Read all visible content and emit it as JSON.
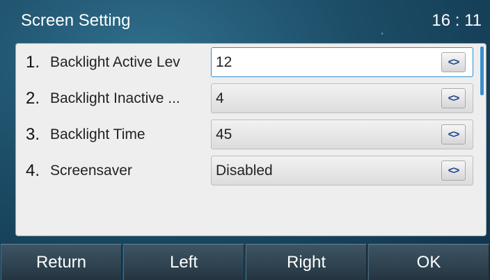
{
  "header": {
    "title": "Screen Setting",
    "clock": "16 : 11"
  },
  "settings": [
    {
      "index": "1.",
      "label": "Backlight Active Lev",
      "value": "12"
    },
    {
      "index": "2.",
      "label": "Backlight Inactive ...",
      "value": "4"
    },
    {
      "index": "3.",
      "label": "Backlight Time",
      "value": "45"
    },
    {
      "index": "4.",
      "label": "Screensaver",
      "value": "Disabled"
    }
  ],
  "arrow_glyph": "<>",
  "softkeys": [
    "Return",
    "Left",
    "Right",
    "OK"
  ],
  "colors": {
    "accent": "#2e8fd0",
    "arrow": "#1a3f8a"
  }
}
